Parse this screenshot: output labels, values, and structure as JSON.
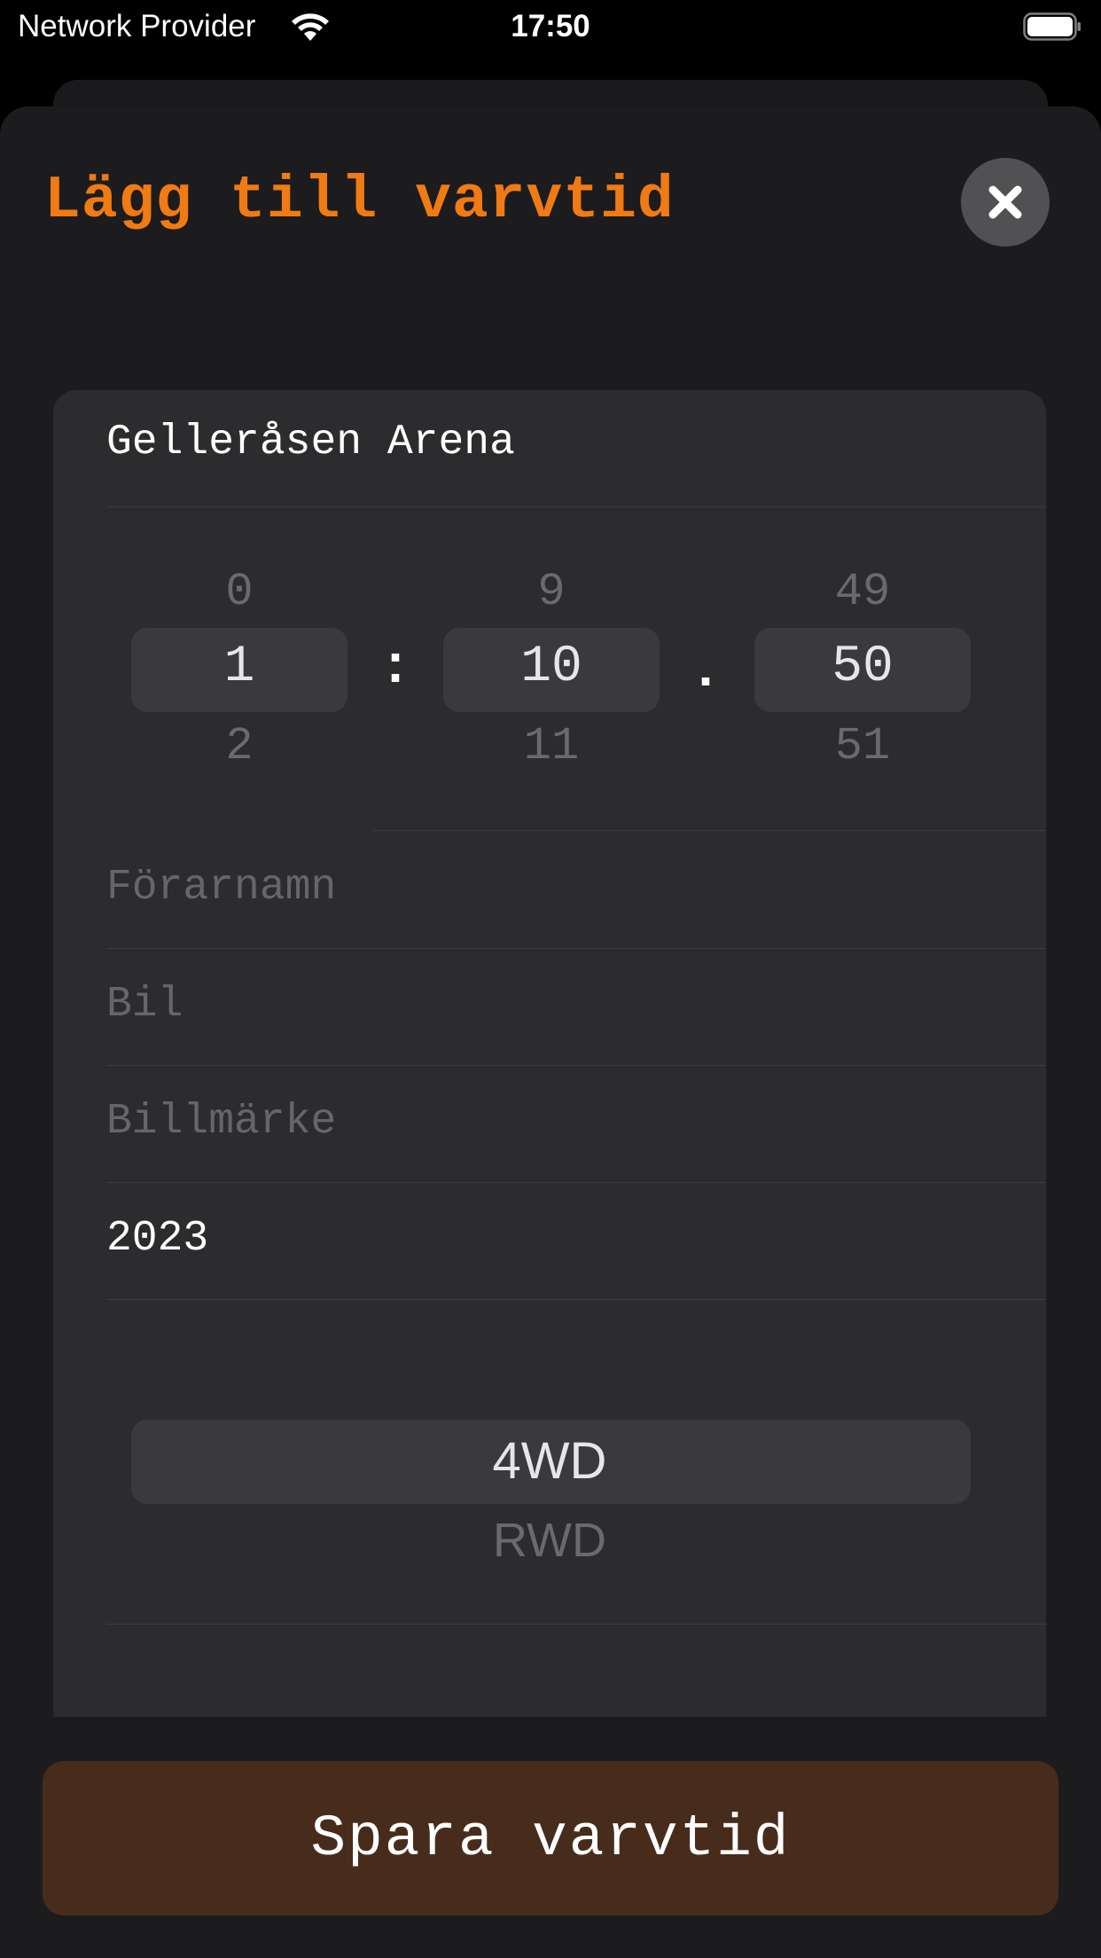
{
  "status_bar": {
    "carrier": "Network Provider",
    "time": "17:50",
    "wifi_icon": "wifi-icon",
    "battery_icon": "battery-full-icon"
  },
  "header": {
    "title": "Lägg till varvtid",
    "close_icon": "close-icon",
    "accent_color": "#f07a14"
  },
  "form": {
    "track_name": "Gelleråsen Arena",
    "lap_time_picker": {
      "minutes": {
        "above": "0",
        "selected": "1",
        "below": "2"
      },
      "seconds": {
        "above": "9",
        "selected": "10",
        "below": "11"
      },
      "hundredths": {
        "above": "49",
        "selected": "50",
        "below": "51"
      },
      "separator_1": ":",
      "separator_2": "."
    },
    "driver_name": {
      "placeholder": "Förarnamn",
      "value": ""
    },
    "car": {
      "placeholder": "Bil",
      "value": ""
    },
    "car_brand": {
      "placeholder": "Billmärke",
      "value": ""
    },
    "year": {
      "value": "2023"
    },
    "drivetrain_picker": {
      "selected": "4WD",
      "below": "RWD"
    }
  },
  "save_button": {
    "label": "Spara varvtid",
    "color": "#472c1c"
  }
}
